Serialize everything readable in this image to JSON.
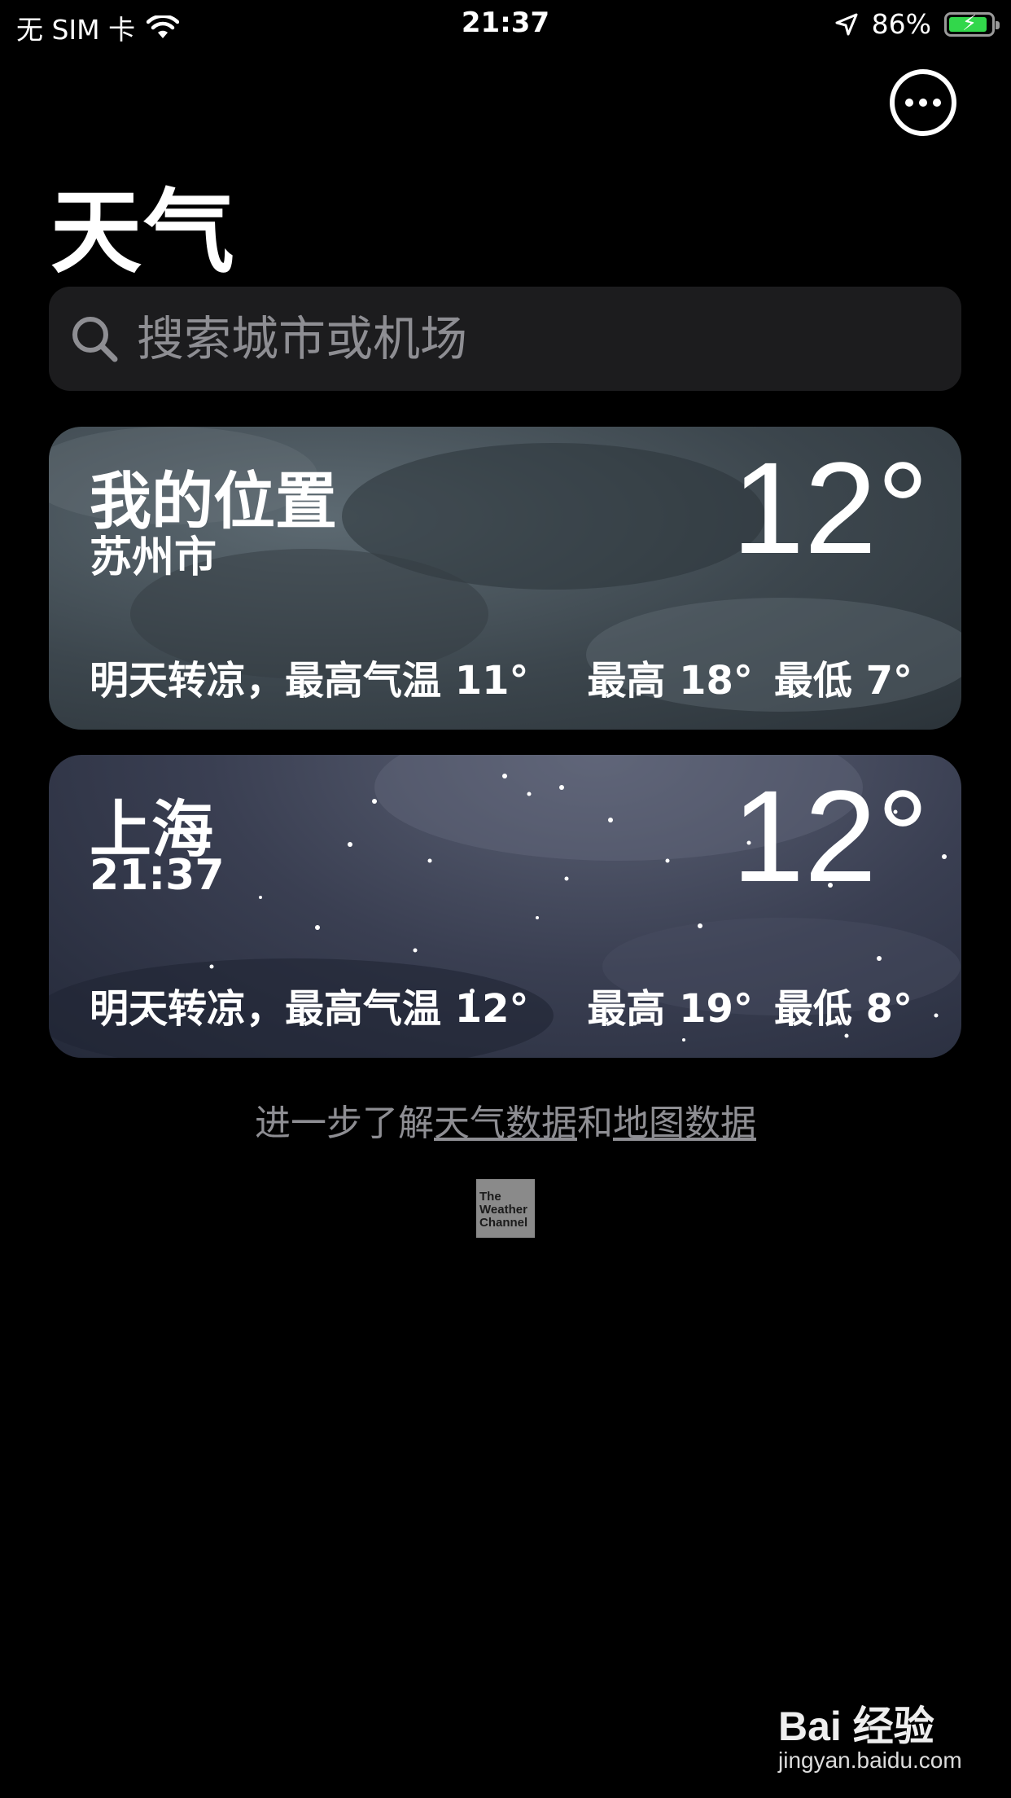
{
  "status_bar": {
    "carrier": "无 SIM 卡",
    "time": "21:37",
    "battery_percent": "86%",
    "battery_level": 0.86,
    "icons": [
      "wifi-icon",
      "location-arrow-icon",
      "battery-charging-icon"
    ]
  },
  "header": {
    "title": "天气",
    "more_icon": "ellipsis-circle-icon"
  },
  "search": {
    "placeholder": "搜索城市或机场",
    "icon": "search-icon"
  },
  "cities": [
    {
      "name": "我的位置",
      "subtitle": "苏州市",
      "temperature": "12°",
      "forecast": "明天转凉，最高气温 11°",
      "high": "最高 18°",
      "low": "最低 7°",
      "background": "cloudy-night"
    },
    {
      "name": "上海",
      "subtitle": "21:37",
      "temperature": "12°",
      "forecast": "明天转凉，最高气温 12°",
      "high": "最高 19°",
      "low": "最低 8°",
      "background": "starry-night"
    }
  ],
  "footer": {
    "prefix": "进一步了解",
    "weather_data_link": "天气数据",
    "connector": "和",
    "map_data_link": "地图数据"
  },
  "provider_logo": {
    "line1": "The",
    "line2": "Weather",
    "line3": "Channel"
  },
  "watermark": {
    "brand": "Bai 经验",
    "url": "jingyan.baidu.com"
  },
  "colors": {
    "background": "#000000",
    "search_bg": "#1c1c1e",
    "placeholder": "#8e8e93",
    "battery_green": "#32d74b"
  }
}
